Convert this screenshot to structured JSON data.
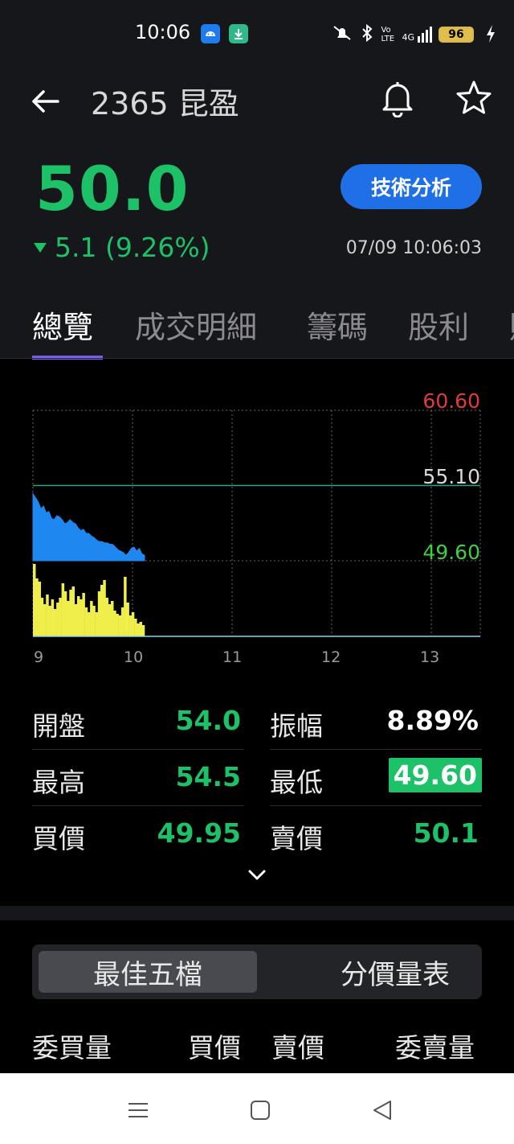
{
  "status_bar": {
    "time": "10:06",
    "battery": "96",
    "network": "4G",
    "volte": "Vo LTE"
  },
  "header": {
    "stock_title": "2365 昆盈",
    "price": "50.0",
    "change": "5.1 (9.26%)",
    "timestamp": "07/09 10:06:03",
    "tech_button": "技術分析",
    "price_color": "#1dc167",
    "accent_color": "#1f6fe6"
  },
  "tabs": [
    {
      "label": "總覽"
    },
    {
      "label": "成交明細"
    },
    {
      "label": "籌碼"
    },
    {
      "label": "股利"
    }
  ],
  "chart": {
    "y_labels": {
      "high": "60.60",
      "ref": "55.10",
      "low": "49.60"
    },
    "x_labels": [
      "9",
      "10",
      "11",
      "12",
      "13"
    ]
  },
  "chart_data": {
    "type": "area",
    "x_label_ticks": [
      "9",
      "10",
      "11",
      "12",
      "13"
    ],
    "ylim": [
      49.6,
      60.6
    ],
    "reference_price": 55.1,
    "price_series": {
      "color": "#1e88f0",
      "values": [
        54.5,
        54.2,
        53.9,
        53.4,
        53.6,
        53.1,
        53.2,
        52.7,
        52.6,
        52.9,
        52.8,
        52.6,
        52.3,
        52.4,
        52.6,
        52.4,
        52.3,
        52.0,
        51.8,
        51.9,
        51.6,
        51.6,
        51.4,
        51.3,
        51.1,
        51.0,
        51.0,
        50.9,
        50.9,
        50.8,
        50.8,
        50.6,
        50.4,
        50.3,
        50.2,
        50.0,
        50.2,
        50.5,
        50.6,
        50.3,
        50.5,
        50.1,
        50.0
      ]
    },
    "volume_series": {
      "color": "#f0ee4a",
      "values": [
        90,
        72,
        68,
        48,
        40,
        52,
        38,
        46,
        34,
        42,
        48,
        66,
        56,
        44,
        58,
        62,
        40,
        50,
        46,
        54,
        36,
        30,
        44,
        38,
        30,
        56,
        64,
        70,
        48,
        40,
        44,
        32,
        28,
        26,
        36,
        74,
        42,
        26,
        30,
        22,
        16,
        18,
        14
      ]
    },
    "grid": true
  },
  "stats": {
    "open_label": "開盤",
    "open": "54.0",
    "amplitude_label": "振幅",
    "amplitude": "8.89%",
    "high_label": "最高",
    "high": "54.5",
    "low_label": "最低",
    "low": "49.60",
    "bid_label": "買價",
    "bid": "49.95",
    "ask_label": "賣價",
    "ask": "50.1"
  },
  "order_book": {
    "seg_best_five": "最佳五檔",
    "seg_price_volume": "分價量表",
    "col_bid_qty": "委買量",
    "col_bid_price": "買價",
    "col_ask_price": "賣價",
    "col_ask_qty": "委賣量"
  }
}
